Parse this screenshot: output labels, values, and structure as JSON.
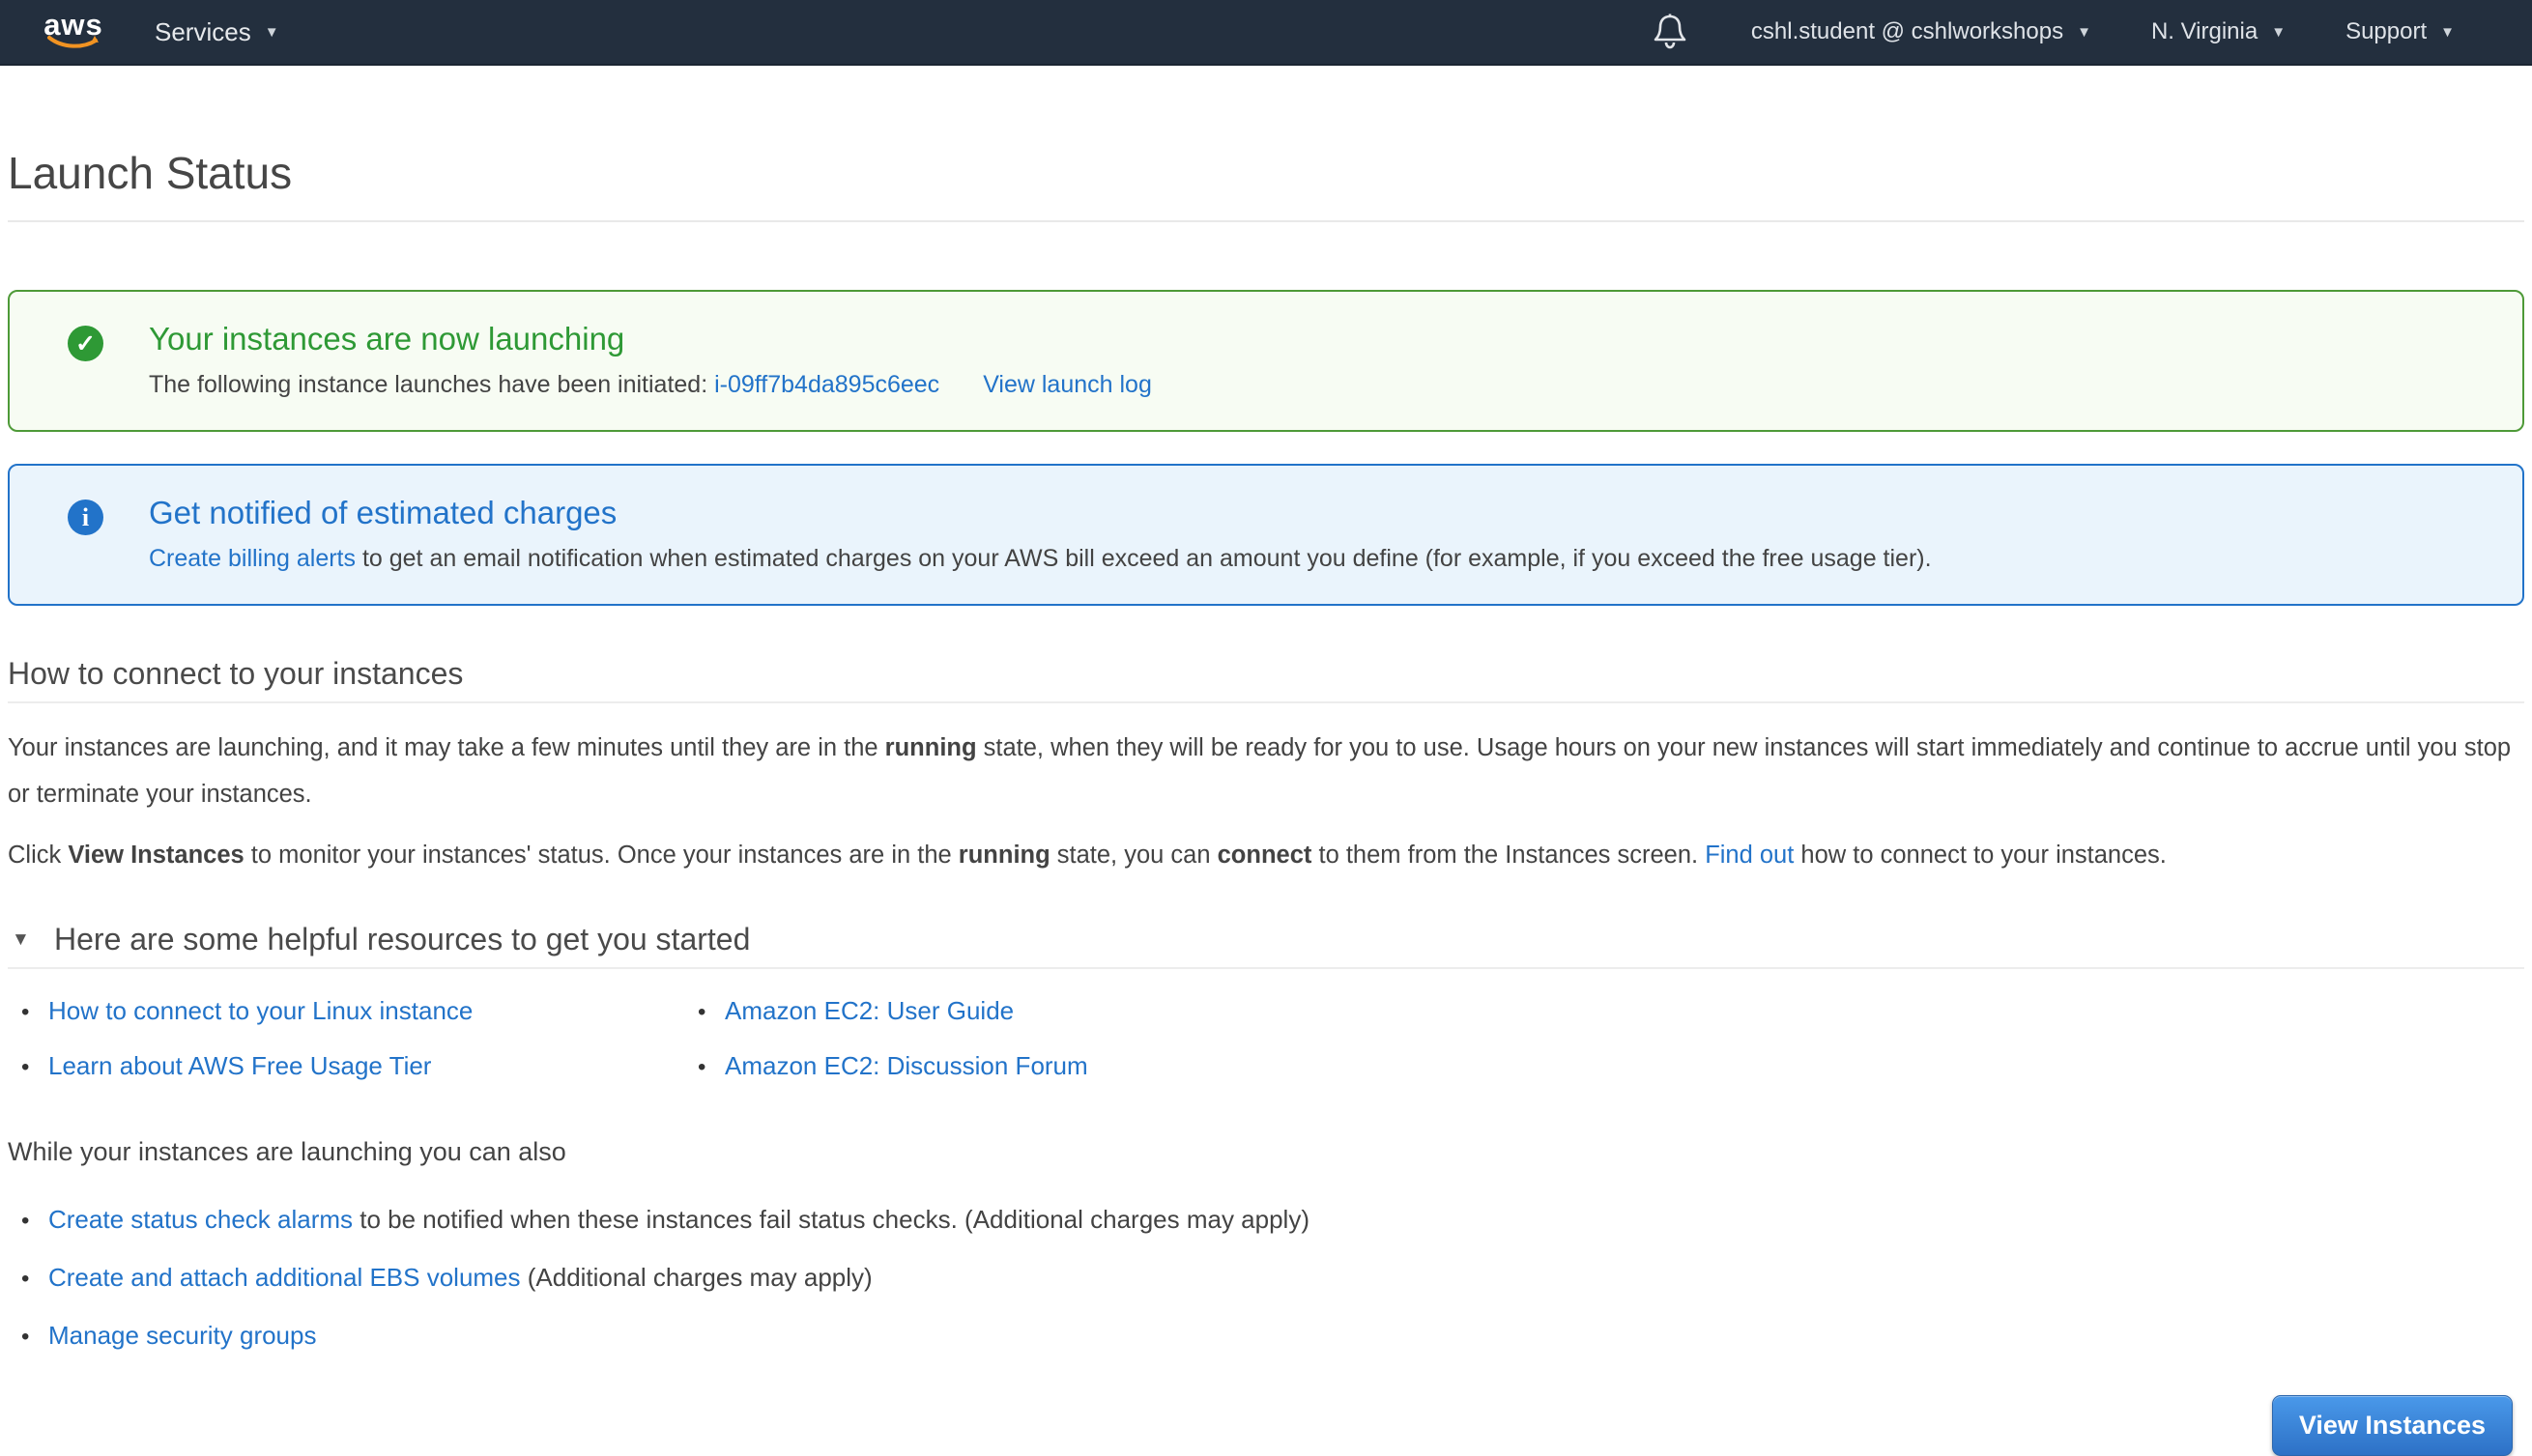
{
  "nav": {
    "logo_text": "aws",
    "services_label": "Services",
    "account_label": "cshl.student @ cshlworkshops",
    "region_label": "N. Virginia",
    "support_label": "Support"
  },
  "page": {
    "title": "Launch Status"
  },
  "success": {
    "title": "Your instances are now launching",
    "body_prefix": "The following instance launches have been initiated: ",
    "instance_id": "i-09ff7b4da895c6eec",
    "view_log_label": "View launch log"
  },
  "info": {
    "title": "Get notified of estimated charges",
    "link_label": "Create billing alerts",
    "body": " to get an email notification when estimated charges on your AWS bill exceed an amount you define (for example, if you exceed the free usage tier)."
  },
  "connect": {
    "heading": "How to connect to your instances",
    "p1_1": "Your instances are launching, and it may take a few minutes until they are in the ",
    "p1_b1": "running",
    "p1_2": " state, when they will be ready for you to use. Usage hours on your new instances will start immediately and continue to accrue until you stop or terminate your instances.",
    "p2_1": "Click ",
    "p2_b1": "View Instances",
    "p2_2": " to monitor your instances' status. Once your instances are in the ",
    "p2_b2": "running",
    "p2_3": " state, you can ",
    "p2_b3": "connect",
    "p2_4": " to them from the Instances screen. ",
    "p2_link": "Find out",
    "p2_5": " how to connect to your instances."
  },
  "resources": {
    "heading": "Here are some helpful resources to get you started",
    "col1": [
      "How to connect to your Linux instance",
      "Learn about AWS Free Usage Tier"
    ],
    "col2": [
      "Amazon EC2: User Guide",
      "Amazon EC2: Discussion Forum"
    ]
  },
  "while_launching": {
    "heading": "While your instances are launching you can also",
    "items": [
      {
        "link": "Create status check alarms",
        "rest": " to be notified when these instances fail status checks. (Additional charges may apply)"
      },
      {
        "link": "Create and attach additional EBS volumes",
        "rest": " (Additional charges may apply)"
      },
      {
        "link": "Manage security groups",
        "rest": ""
      }
    ]
  },
  "footer": {
    "button_label": "View Instances"
  },
  "glyphs": {
    "caret_down": "▼",
    "check": "✓",
    "info_i": "i",
    "bullet": "•",
    "collapse_caret": "▼"
  },
  "colors": {
    "nav_background": "#232f3e",
    "aws_orange": "#f19322",
    "success_green": "#2e9935",
    "link_blue": "#2273c9",
    "info_background": "#eaf4fc",
    "success_background": "#f7fcf3",
    "button_gradient_top": "#4a99ea",
    "button_gradient_bottom": "#2d71c6"
  }
}
